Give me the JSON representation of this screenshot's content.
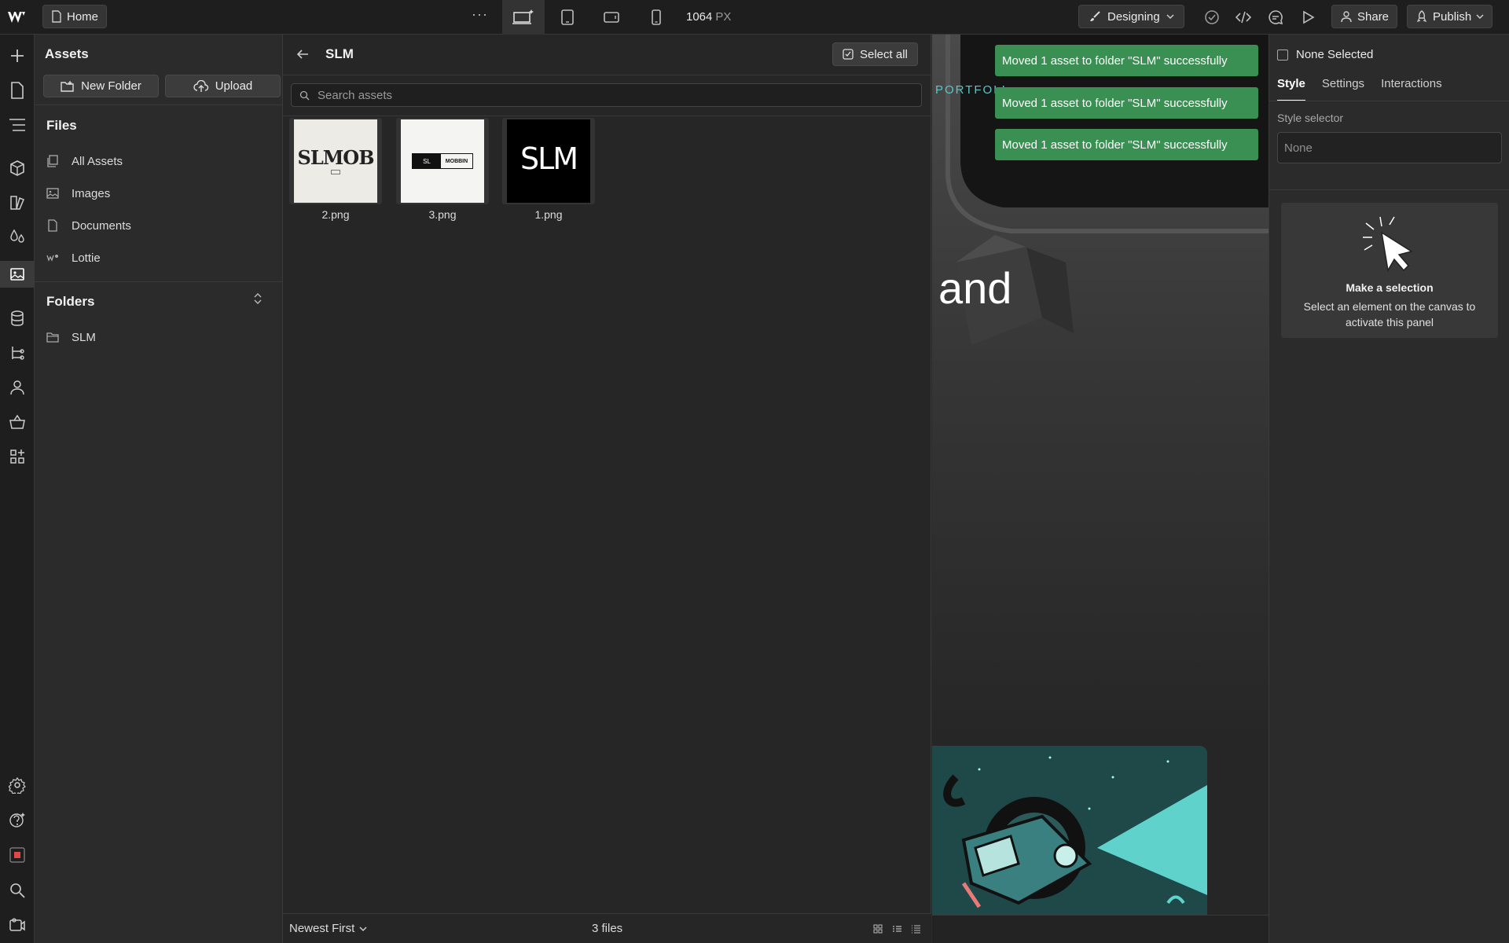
{
  "topbar": {
    "page_label": "Home",
    "more": "···",
    "width_value": "1064",
    "width_unit": "PX",
    "mode_label": "Designing",
    "share_label": "Share",
    "publish_label": "Publish"
  },
  "assets_panel": {
    "title": "Assets",
    "new_folder_label": "New Folder",
    "upload_label": "Upload",
    "files_heading": "Files",
    "file_types": [
      {
        "label": "All Assets",
        "icon": "all-assets-icon"
      },
      {
        "label": "Images",
        "icon": "image-icon"
      },
      {
        "label": "Documents",
        "icon": "document-icon"
      },
      {
        "label": "Lottie",
        "icon": "lottie-icon"
      }
    ],
    "folders_heading": "Folders",
    "folders": [
      {
        "label": "SLM",
        "icon": "folder-icon"
      }
    ]
  },
  "browser": {
    "folder_title": "SLM",
    "select_all_label": "Select all",
    "search_placeholder": "Search assets",
    "files": [
      {
        "name": "2.png",
        "thumb_text": "SLMOB"
      },
      {
        "name": "3.png",
        "thumb_text_left": "SL",
        "thumb_text_right": "MOBBIN"
      },
      {
        "name": "1.png",
        "thumb_text": "SLM"
      }
    ],
    "sort_label": "Newest First",
    "file_count": "3 files"
  },
  "canvas": {
    "toasts": [
      "Moved 1 asset to folder \"SLM\" successfully",
      "Moved 1 asset to folder \"SLM\" successfully",
      "Moved 1 asset to folder \"SLM\" successfully"
    ],
    "nav_text": "PORTFOLI",
    "hero_word": "and",
    "accent_color": "#5cc6c6",
    "toast_color": "#3a8f52"
  },
  "right_panel": {
    "selection_label": "None Selected",
    "tabs": [
      "Style",
      "Settings",
      "Interactions"
    ],
    "style_selector_label": "Style selector",
    "style_selector_value": "None",
    "empty_title": "Make a selection",
    "empty_desc": "Select an element on the canvas to activate this panel"
  }
}
